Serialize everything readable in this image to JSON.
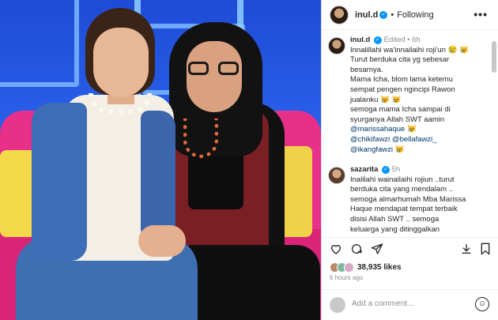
{
  "post": {
    "author": "inul.d",
    "follow_status": "Following",
    "separator": "•"
  },
  "icons": {
    "verified": "✓",
    "more": "•••",
    "like": "heart-icon",
    "comment": "comment-icon",
    "share": "share-icon",
    "save": "bookmark-icon",
    "emoji": "emoji-icon"
  },
  "caption": {
    "user": "inul.d",
    "meta": "Edited • 6h",
    "lines": [
      "Innalillahi wa'innailaihi roji'un 😢 😿",
      "Turut berduka cita yg sebesar",
      "besarnya.",
      "Mama Icha, blom lama ketemu",
      "sempat pengen ngincipi Rawon",
      "jualanku 😿 😿",
      "semoga mama Icha sampai di",
      "syurganya Allah SWT aamin",
      "@marissahaque 😿",
      "@chikifawzi @bellafawzi_",
      "@ikangfawzi 😿"
    ]
  },
  "comment": {
    "user": "sazarita",
    "meta": "5h",
    "lines": [
      "Inalilahi wainailaihi rojiun ..turut",
      "berduka cita yang mendalam ..",
      "semoga almarhumah Mba Marissa",
      "Haque mendapat tempat terbaik",
      "disisi Allah SWT .. semoga",
      "keluarga yang ditinggalkan"
    ]
  },
  "likes": {
    "count": "38,935 likes"
  },
  "timestamp": "6 hours ago",
  "add_comment": {
    "placeholder": "Add a comment..."
  },
  "colors": {
    "verified": "#0095f6",
    "mention": "#00376b",
    "meta_gray": "#8e8e8e"
  }
}
